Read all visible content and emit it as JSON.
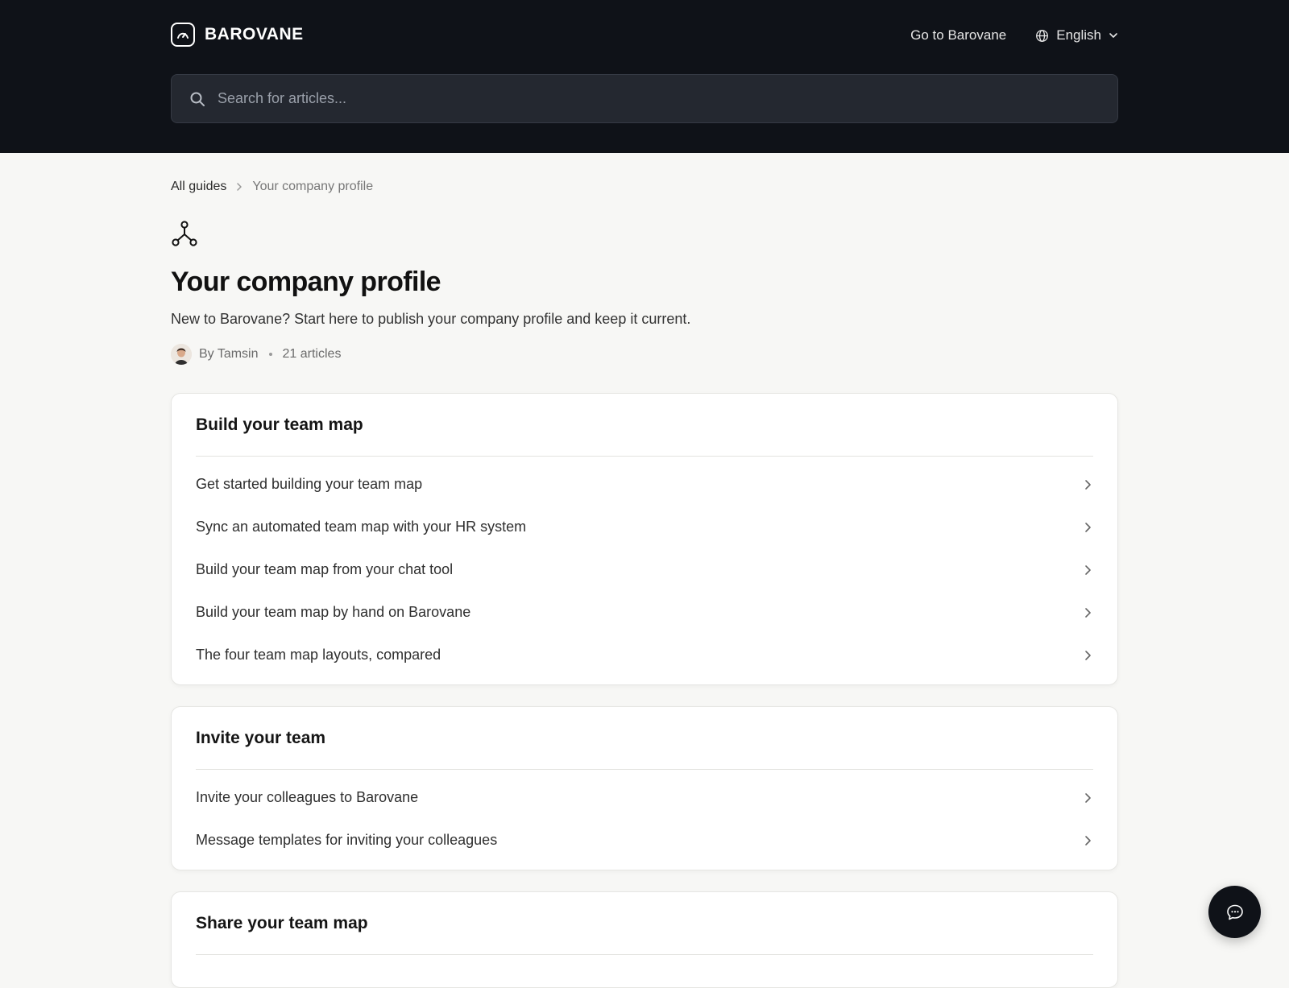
{
  "header": {
    "brand_name": "BAROVANE",
    "go_to_label": "Go to Barovane",
    "language": "English",
    "search_placeholder": "Search for articles..."
  },
  "breadcrumb": {
    "root": "All guides",
    "current": "Your company profile"
  },
  "collection": {
    "icon": "network-icon",
    "title": "Your company profile",
    "description": "New to Barovane? Start here to publish your company profile and keep it current.",
    "author": "By Tamsin",
    "article_count": "21 articles"
  },
  "sections": [
    {
      "title": "Build your team map",
      "articles": [
        "Get started building your team map",
        "Sync an automated team map with your HR system",
        "Build your team map from your chat tool",
        "Build your team map by hand on Barovane",
        "The four team map layouts, compared"
      ]
    },
    {
      "title": "Invite your team",
      "articles": [
        "Invite your colleagues to Barovane",
        "Message templates for inviting your colleagues"
      ]
    },
    {
      "title": "Share your team map",
      "articles": []
    }
  ],
  "colors": {
    "header_bg": "#0f1218",
    "page_bg": "#f7f7f5",
    "card_bg": "#ffffff"
  }
}
